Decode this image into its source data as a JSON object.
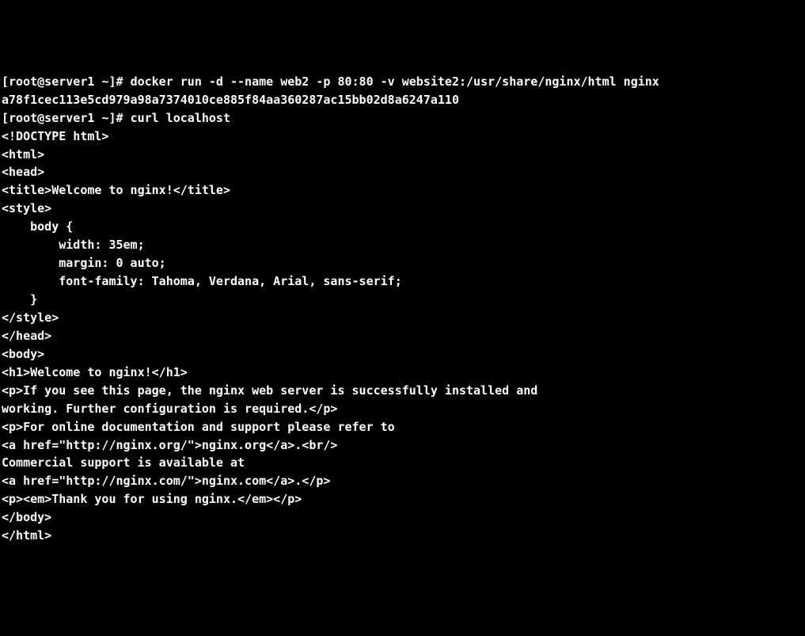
{
  "terminal": {
    "prompt1": "[root@server1 ~]# ",
    "command1": "docker run -d --name web2 -p 80:80 -v website2:/usr/share/nginx/html nginx",
    "output1": "a78f1cec113e5cd979a98a7374010ce885f84aa360287ac15bb02d8a6247a110",
    "prompt2": "[root@server1 ~]# ",
    "command2": "curl localhost",
    "lines": [
      "<!DOCTYPE html>",
      "<html>",
      "<head>",
      "<title>Welcome to nginx!</title>",
      "<style>",
      "    body {",
      "        width: 35em;",
      "        margin: 0 auto;",
      "        font-family: Tahoma, Verdana, Arial, sans-serif;",
      "    }",
      "</style>",
      "</head>",
      "<body>",
      "<h1>Welcome to nginx!</h1>",
      "<p>If you see this page, the nginx web server is successfully installed and",
      "working. Further configuration is required.</p>",
      "",
      "<p>For online documentation and support please refer to",
      "<a href=\"http://nginx.org/\">nginx.org</a>.<br/>",
      "Commercial support is available at",
      "<a href=\"http://nginx.com/\">nginx.com</a>.</p>",
      "",
      "<p><em>Thank you for using nginx.</em></p>",
      "</body>",
      "</html>"
    ]
  }
}
